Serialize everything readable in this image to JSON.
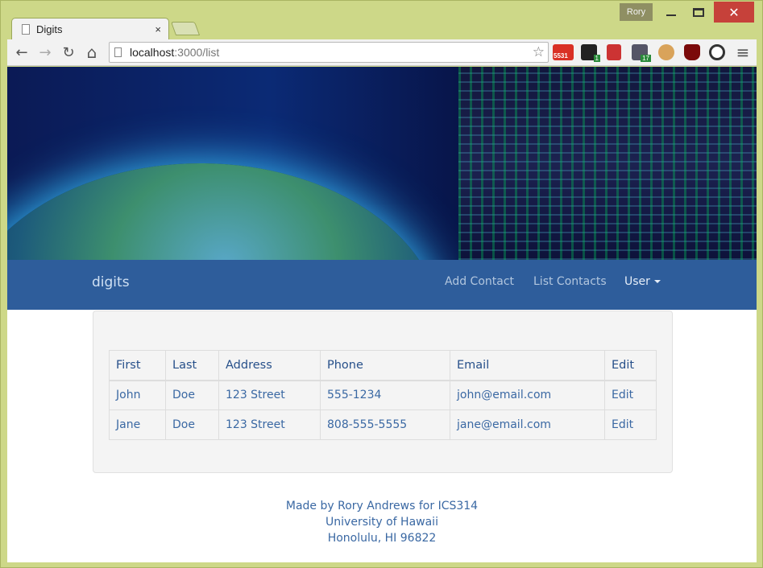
{
  "window": {
    "user_badge": "Rory",
    "tab_title": "Digits",
    "tab_close": "×",
    "close_glyph": "✕"
  },
  "toolbar": {
    "url_host": "localhost",
    "url_path": ":3000/list",
    "back_glyph": "←",
    "forward_glyph": "→",
    "reload_glyph": "↻",
    "home_glyph": "⌂",
    "star_glyph": "☆",
    "menu_glyph": "≡",
    "gmail_badge": "5531",
    "ext_badge_1": "1",
    "ext_badge_2": "17"
  },
  "navbar": {
    "brand": "digits",
    "links": [
      "Add Contact",
      "List Contacts"
    ],
    "user_label": "User"
  },
  "table": {
    "headers": [
      "First",
      "Last",
      "Address",
      "Phone",
      "Email",
      "Edit"
    ],
    "rows": [
      [
        "John",
        "Doe",
        "123 Street",
        "555-1234",
        "john@email.com",
        "Edit"
      ],
      [
        "Jane",
        "Doe",
        "123 Street",
        "808-555-5555",
        "jane@email.com",
        "Edit"
      ]
    ]
  },
  "footer": {
    "line1": "Made by Rory Andrews for ICS314",
    "line2": "University of Hawaii",
    "line3": "Honolulu, HI 96822"
  },
  "colors": {
    "navbar": "#2e5d9b",
    "link": "#3a68a3",
    "frame": "#cdd888",
    "close": "#c6413a"
  }
}
